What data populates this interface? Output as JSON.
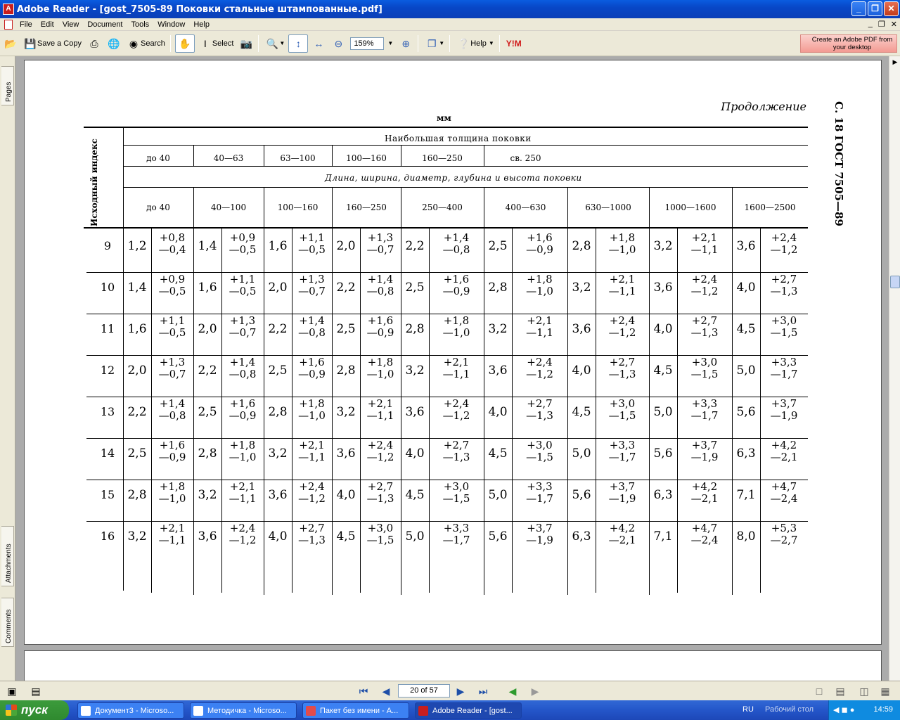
{
  "window": {
    "title": "Adobe Reader - [gost_7505-89 Поковки стальные штампованные.pdf]",
    "minimize": "_",
    "restore": "❐",
    "close": "✕"
  },
  "menu": {
    "items": [
      "File",
      "Edit",
      "View",
      "Document",
      "Tools",
      "Window",
      "Help"
    ],
    "mdi_minimize": "_",
    "mdi_restore": "❐",
    "mdi_close": "✕"
  },
  "toolbar": {
    "save_copy": "Save a Copy",
    "search": "Search",
    "select": "Select",
    "zoom": "159%",
    "help": "Help",
    "promo": "Create an Adobe PDF from your desktop"
  },
  "navtabs": [
    "Pages",
    "Attachments",
    "Comments"
  ],
  "document": {
    "continuation": "Продолжение",
    "sidenote": "С. 18 ГОСТ 7505—89",
    "unit": "мм",
    "index_header": "Исходный индекс",
    "thickness_header": "Наибольшая толщина поковки",
    "thickness_ranges": [
      "до 40",
      "40—63",
      "63—100",
      "100—160",
      "160—250",
      "св. 250"
    ],
    "dimension_header": "Длина, ширина, диаметр, глубина и высота поковки",
    "dimension_ranges": [
      "до 40",
      "40—100",
      "100—160",
      "160—250",
      "250—400",
      "400—630",
      "630—1000",
      "1000—1600",
      "1600—2500"
    ],
    "rows": [
      {
        "index": "9",
        "cells": [
          [
            "1,2",
            "+0,8",
            "—0,4"
          ],
          [
            "1,4",
            "+0,9",
            "—0,5"
          ],
          [
            "1,6",
            "+1,1",
            "—0,5"
          ],
          [
            "2,0",
            "+1,3",
            "—0,7"
          ],
          [
            "2,2",
            "+1,4",
            "—0,8"
          ],
          [
            "2,5",
            "+1,6",
            "—0,9"
          ],
          [
            "2,8",
            "+1,8",
            "—1,0"
          ],
          [
            "3,2",
            "+2,1",
            "—1,1"
          ],
          [
            "3,6",
            "+2,4",
            "—1,2"
          ]
        ]
      },
      {
        "index": "10",
        "cells": [
          [
            "1,4",
            "+0,9",
            "—0,5"
          ],
          [
            "1,6",
            "+1,1",
            "—0,5"
          ],
          [
            "2,0",
            "+1,3",
            "—0,7"
          ],
          [
            "2,2",
            "+1,4",
            "—0,8"
          ],
          [
            "2,5",
            "+1,6",
            "—0,9"
          ],
          [
            "2,8",
            "+1,8",
            "—1,0"
          ],
          [
            "3,2",
            "+2,1",
            "—1,1"
          ],
          [
            "3,6",
            "+2,4",
            "—1,2"
          ],
          [
            "4,0",
            "+2,7",
            "—1,3"
          ]
        ]
      },
      {
        "index": "11",
        "cells": [
          [
            "1,6",
            "+1,1",
            "—0,5"
          ],
          [
            "2,0",
            "+1,3",
            "—0,7"
          ],
          [
            "2,2",
            "+1,4",
            "—0,8"
          ],
          [
            "2,5",
            "+1,6",
            "—0,9"
          ],
          [
            "2,8",
            "+1,8",
            "—1,0"
          ],
          [
            "3,2",
            "+2,1",
            "—1,1"
          ],
          [
            "3,6",
            "+2,4",
            "—1,2"
          ],
          [
            "4,0",
            "+2,7",
            "—1,3"
          ],
          [
            "4,5",
            "+3,0",
            "—1,5"
          ]
        ]
      },
      {
        "index": "12",
        "cells": [
          [
            "2,0",
            "+1,3",
            "—0,7"
          ],
          [
            "2,2",
            "+1,4",
            "—0,8"
          ],
          [
            "2,5",
            "+1,6",
            "—0,9"
          ],
          [
            "2,8",
            "+1,8",
            "—1,0"
          ],
          [
            "3,2",
            "+2,1",
            "—1,1"
          ],
          [
            "3,6",
            "+2,4",
            "—1,2"
          ],
          [
            "4,0",
            "+2,7",
            "—1,3"
          ],
          [
            "4,5",
            "+3,0",
            "—1,5"
          ],
          [
            "5,0",
            "+3,3",
            "—1,7"
          ]
        ]
      },
      {
        "index": "13",
        "cells": [
          [
            "2,2",
            "+1,4",
            "—0,8"
          ],
          [
            "2,5",
            "+1,6",
            "—0,9"
          ],
          [
            "2,8",
            "+1,8",
            "—1,0"
          ],
          [
            "3,2",
            "+2,1",
            "—1,1"
          ],
          [
            "3,6",
            "+2,4",
            "—1,2"
          ],
          [
            "4,0",
            "+2,7",
            "—1,3"
          ],
          [
            "4,5",
            "+3,0",
            "—1,5"
          ],
          [
            "5,0",
            "+3,3",
            "—1,7"
          ],
          [
            "5,6",
            "+3,7",
            "—1,9"
          ]
        ]
      },
      {
        "index": "14",
        "cells": [
          [
            "2,5",
            "+1,6",
            "—0,9"
          ],
          [
            "2,8",
            "+1,8",
            "—1,0"
          ],
          [
            "3,2",
            "+2,1",
            "—1,1"
          ],
          [
            "3,6",
            "+2,4",
            "—1,2"
          ],
          [
            "4,0",
            "+2,7",
            "—1,3"
          ],
          [
            "4,5",
            "+3,0",
            "—1,5"
          ],
          [
            "5,0",
            "+3,3",
            "—1,7"
          ],
          [
            "5,6",
            "+3,7",
            "—1,9"
          ],
          [
            "6,3",
            "+4,2",
            "—2,1"
          ]
        ]
      },
      {
        "index": "15",
        "cells": [
          [
            "2,8",
            "+1,8",
            "—1,0"
          ],
          [
            "3,2",
            "+2,1",
            "—1,1"
          ],
          [
            "3,6",
            "+2,4",
            "—1,2"
          ],
          [
            "4,0",
            "+2,7",
            "—1,3"
          ],
          [
            "4,5",
            "+3,0",
            "—1,5"
          ],
          [
            "5,0",
            "+3,3",
            "—1,7"
          ],
          [
            "5,6",
            "+3,7",
            "—1,9"
          ],
          [
            "6,3",
            "+4,2",
            "—2,1"
          ],
          [
            "7,1",
            "+4,7",
            "—2,4"
          ]
        ]
      },
      {
        "index": "16",
        "cells": [
          [
            "3,2",
            "+2,1",
            "—1,1"
          ],
          [
            "3,6",
            "+2,4",
            "—1,2"
          ],
          [
            "4,0",
            "+2,7",
            "—1,3"
          ],
          [
            "4,5",
            "+3,0",
            "—1,5"
          ],
          [
            "5,0",
            "+3,3",
            "—1,7"
          ],
          [
            "5,6",
            "+3,7",
            "—1,9"
          ],
          [
            "6,3",
            "+4,2",
            "—2,1"
          ],
          [
            "7,1",
            "+4,7",
            "—2,4"
          ],
          [
            "8,0",
            "+5,3",
            "—2,7"
          ]
        ]
      }
    ]
  },
  "status": {
    "page": "20 of 57"
  },
  "taskbar": {
    "start": "пуск",
    "tasks": [
      "Документ3 - Microso...",
      "Методичка - Microso...",
      "Пакет без имени - A...",
      "Adobe Reader - [gost..."
    ],
    "lang": "RU",
    "desktop": "Рабочий стол",
    "clock": "14:59"
  }
}
